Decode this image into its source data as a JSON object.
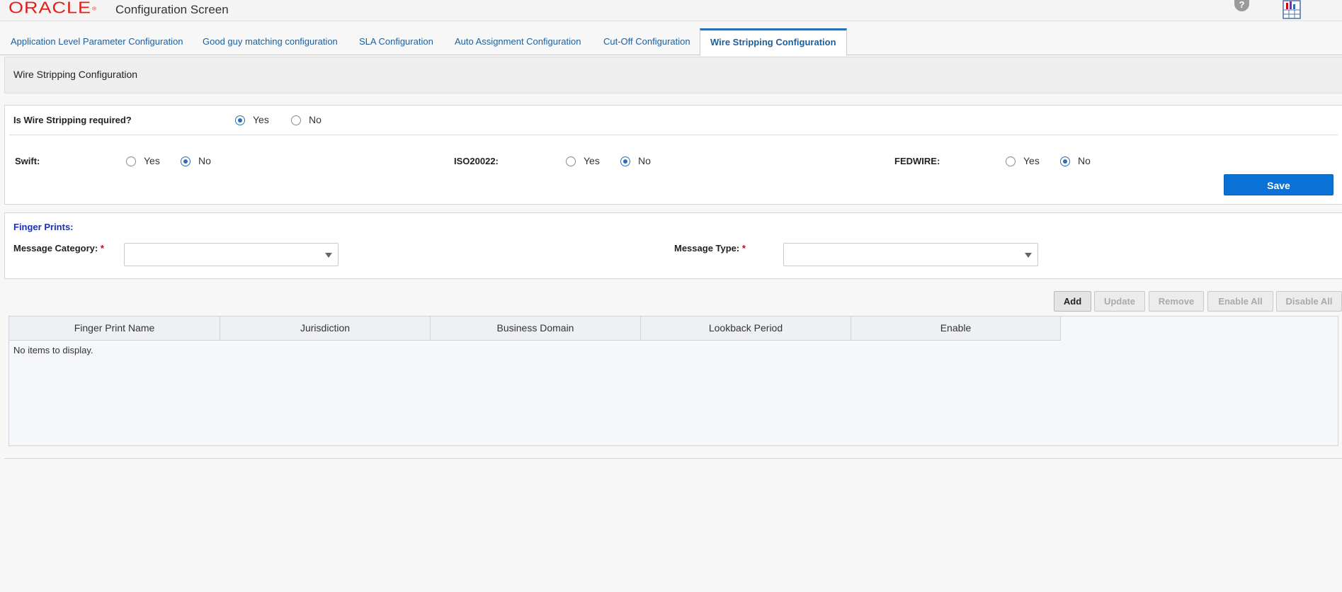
{
  "header": {
    "logo_text": "ORACLE",
    "logo_reg": "®",
    "title": "Configuration Screen",
    "help_label": "?",
    "brand_color": "#e0201b"
  },
  "tabs": [
    {
      "label": "Application Level Parameter Configuration",
      "active": false
    },
    {
      "label": "Good guy matching configuration",
      "active": false
    },
    {
      "label": "SLA Configuration",
      "active": false
    },
    {
      "label": "Auto Assignment Configuration",
      "active": false
    },
    {
      "label": "Cut-Off Configuration",
      "active": false
    },
    {
      "label": "Wire Stripping Configuration",
      "active": true
    }
  ],
  "section_title": "Wire Stripping Configuration",
  "wire_stripping": {
    "question": "Is Wire Stripping required?",
    "selected": "Yes",
    "yes_label": "Yes",
    "no_label": "No"
  },
  "networks": [
    {
      "label": "Swift:",
      "yes_label": "Yes",
      "no_label": "No",
      "selected": "No"
    },
    {
      "label": "ISO20022:",
      "yes_label": "Yes",
      "no_label": "No",
      "selected": "No"
    },
    {
      "label": "FEDWIRE:",
      "yes_label": "Yes",
      "no_label": "No",
      "selected": "No"
    }
  ],
  "save_label": "Save",
  "finger_prints": {
    "title": "Finger Prints:",
    "message_category_label": "Message Category:",
    "message_type_label": "Message Type:",
    "required_mark": "*",
    "message_category_value": "",
    "message_type_value": ""
  },
  "toolbar": {
    "add": "Add",
    "update": "Update",
    "remove": "Remove",
    "enable_all": "Enable All",
    "disable_all": "Disable All"
  },
  "grid": {
    "columns": [
      "Finger Print Name",
      "Jurisdiction",
      "Business Domain",
      "Lookback Period",
      "Enable"
    ],
    "empty_text": "No items to display.",
    "rows": []
  },
  "colors": {
    "accent": "#2a6fb5",
    "save_button": "#0a72d6",
    "finger_prints_title": "#1a2fb5"
  }
}
